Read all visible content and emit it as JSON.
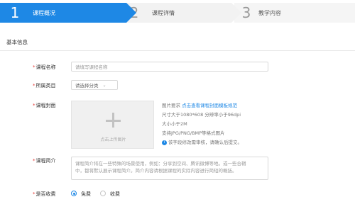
{
  "steps": [
    {
      "num": "1",
      "title": "课程概况"
    },
    {
      "num": "2",
      "title": "课程详情"
    },
    {
      "num": "3",
      "title": "教学内容"
    }
  ],
  "section": {
    "title": "基本信息"
  },
  "form": {
    "required_mark": "*",
    "name": {
      "label": "课程名称",
      "placeholder": "请填写课程名称"
    },
    "category": {
      "label": "所属类目",
      "value": "请选择分类"
    },
    "cover": {
      "label": "课程封面",
      "upload_text": "点击上传图片",
      "req_prefix": "图片要求",
      "req_link": "点击查看课程封面模板规范",
      "req_size": "尺寸大于1080*608 分辨率小于96dpi",
      "req_filesize": "大小小于2M",
      "req_format": "支持JPG/PNG/BMP等格式图片",
      "notice": "该字段修改需审核，请确认后提交。"
    },
    "intro": {
      "label": "课程简介",
      "placeholder_line1": "课程简介将在一些特殊的场景使用，例如：分享到空间、腾讯微博等地。或一些合辑",
      "placeholder_line2": "中，都将默认展示课程简介。简介内容请根据课程的实际内容进行简短的概括。"
    },
    "charge": {
      "label": "是否收费",
      "options": [
        "免费",
        "收费"
      ],
      "selected": "免费"
    }
  },
  "colors": {
    "accent": "#1e88e5",
    "required": "#e53935"
  }
}
